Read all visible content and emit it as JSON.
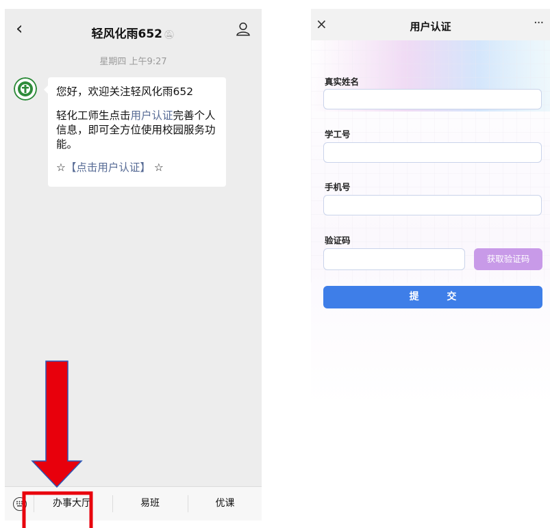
{
  "left": {
    "title": "轻风化雨652",
    "mute_icon": "mute-bell-icon",
    "timestamp": "星期四 上午9:27",
    "message": {
      "greeting": "您好，欢迎关注轻风化雨652",
      "line_prefix": "轻化工师生点击",
      "link_text": "用户认证",
      "line_suffix": "完善个人信息，即可全方位使用校园服务功能。",
      "star_open": "☆",
      "action_link": "【点击用户认证】",
      "star_close": "☆"
    },
    "menu": [
      "办事大厅",
      "易班",
      "优课"
    ],
    "annotation_color": "#e8000c"
  },
  "right": {
    "close": "×",
    "title": "用户认证",
    "more": "···",
    "fields": [
      {
        "label": "真实姓名",
        "value": ""
      },
      {
        "label": "学工号",
        "value": ""
      },
      {
        "label": "手机号",
        "value": ""
      },
      {
        "label": "验证码",
        "value": ""
      }
    ],
    "get_code": "获取验证码",
    "submit": "提 交",
    "accent": "#3e7ee8",
    "code_button_color": "#c89ae8"
  }
}
